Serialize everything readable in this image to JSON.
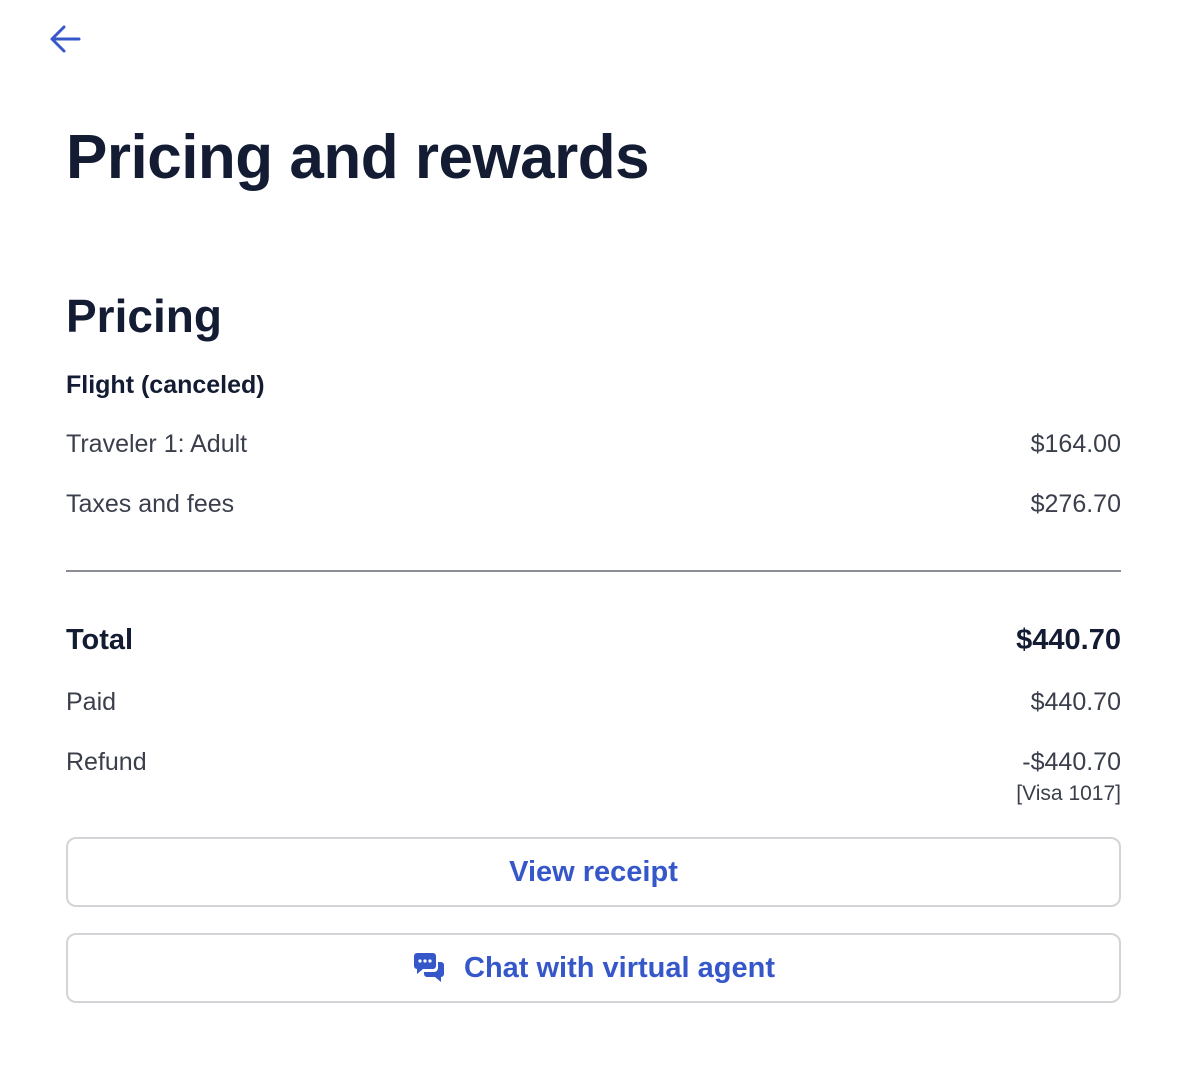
{
  "header": {
    "back_icon": "arrow-left-icon",
    "title": "Pricing and rewards"
  },
  "pricing": {
    "section_title": "Pricing",
    "flight_label": "Flight (canceled)",
    "line_items": [
      {
        "label": "Traveler 1: Adult",
        "amount": "$164.00"
      },
      {
        "label": "Taxes and fees",
        "amount": "$276.70"
      }
    ],
    "total": {
      "label": "Total",
      "amount": "$440.70"
    },
    "paid": {
      "label": "Paid",
      "amount": "$440.70"
    },
    "refund": {
      "label": "Refund",
      "amount": "-$440.70",
      "method": "[Visa 1017]"
    }
  },
  "actions": {
    "view_receipt_label": "View receipt",
    "chat_label": "Chat with virtual agent",
    "chat_icon": "chat-bubbles-icon"
  },
  "colors": {
    "accent": "#3557c9",
    "text_primary": "#131c33",
    "text_secondary": "#3a3f4b",
    "border": "#d2d4d8",
    "divider": "#8a8d94"
  }
}
